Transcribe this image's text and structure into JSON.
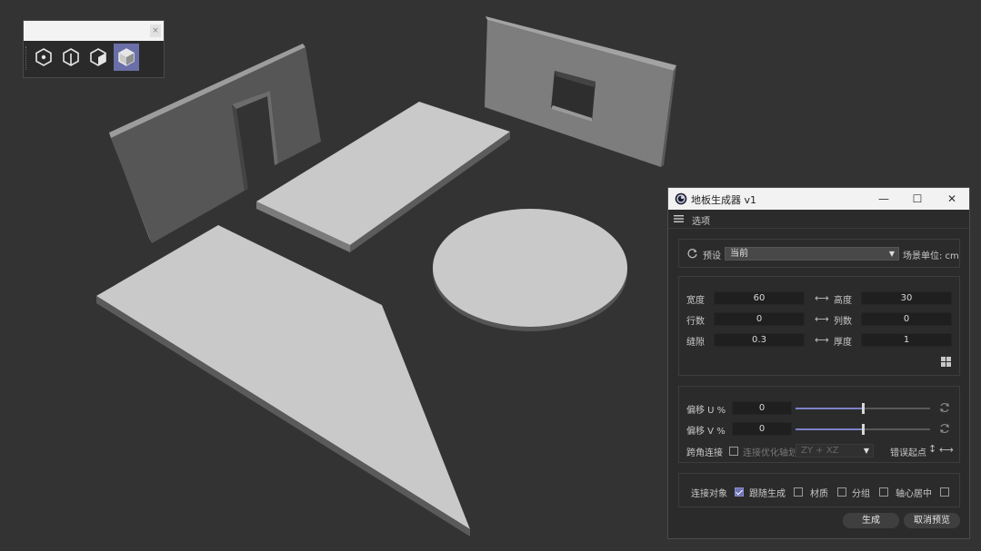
{
  "toolbar": {
    "close_label": "×",
    "buttons": [
      {
        "icon": "hex-point-icon",
        "active": false
      },
      {
        "icon": "hex-edge-icon",
        "active": false
      },
      {
        "icon": "cube-face-icon",
        "active": false
      },
      {
        "icon": "cube-object-icon",
        "active": true
      }
    ]
  },
  "window": {
    "title": "地板生成器 v1",
    "minimize": "—",
    "maximize": "☐",
    "close": "✕",
    "menu_label": "选项"
  },
  "preset": {
    "label": "预设",
    "value": "当前",
    "unit_label": "场景单位: cm"
  },
  "dimensions": {
    "width_label": "宽度",
    "width_value": "60",
    "height_label": "高度",
    "height_value": "30",
    "rows_label": "行数",
    "rows_value": "0",
    "cols_label": "列数",
    "cols_value": "0",
    "gap_label": "缝隙",
    "gap_value": "0.3",
    "thickness_label": "厚度",
    "thickness_value": "1"
  },
  "offsets": {
    "u_label": "偏移 U %",
    "u_value": "0",
    "u_fraction": 0.5,
    "v_label": "偏移 V %",
    "v_value": "0",
    "v_fraction": 0.5,
    "corner_label": "跨角连接",
    "corner_checked": false,
    "optimize_label": "连接优化轴划",
    "axis_value": "ZY + XZ",
    "origin_label": "错误起点"
  },
  "options": {
    "connect_label": "连接对象",
    "connect_checked": true,
    "follow_label": "跟随生成",
    "follow_checked": false,
    "material_label": "材质",
    "material_checked": false,
    "group_label": "分组",
    "group_checked": false,
    "center_label": "轴心居中",
    "center_checked": false
  },
  "actions": {
    "generate": "生成",
    "cancel_preview": "取消预览"
  },
  "colors": {
    "background": "#333333",
    "accent": "#6d73b5",
    "plate_top": "#c7c7c7",
    "wall": "#5e5e5e"
  }
}
